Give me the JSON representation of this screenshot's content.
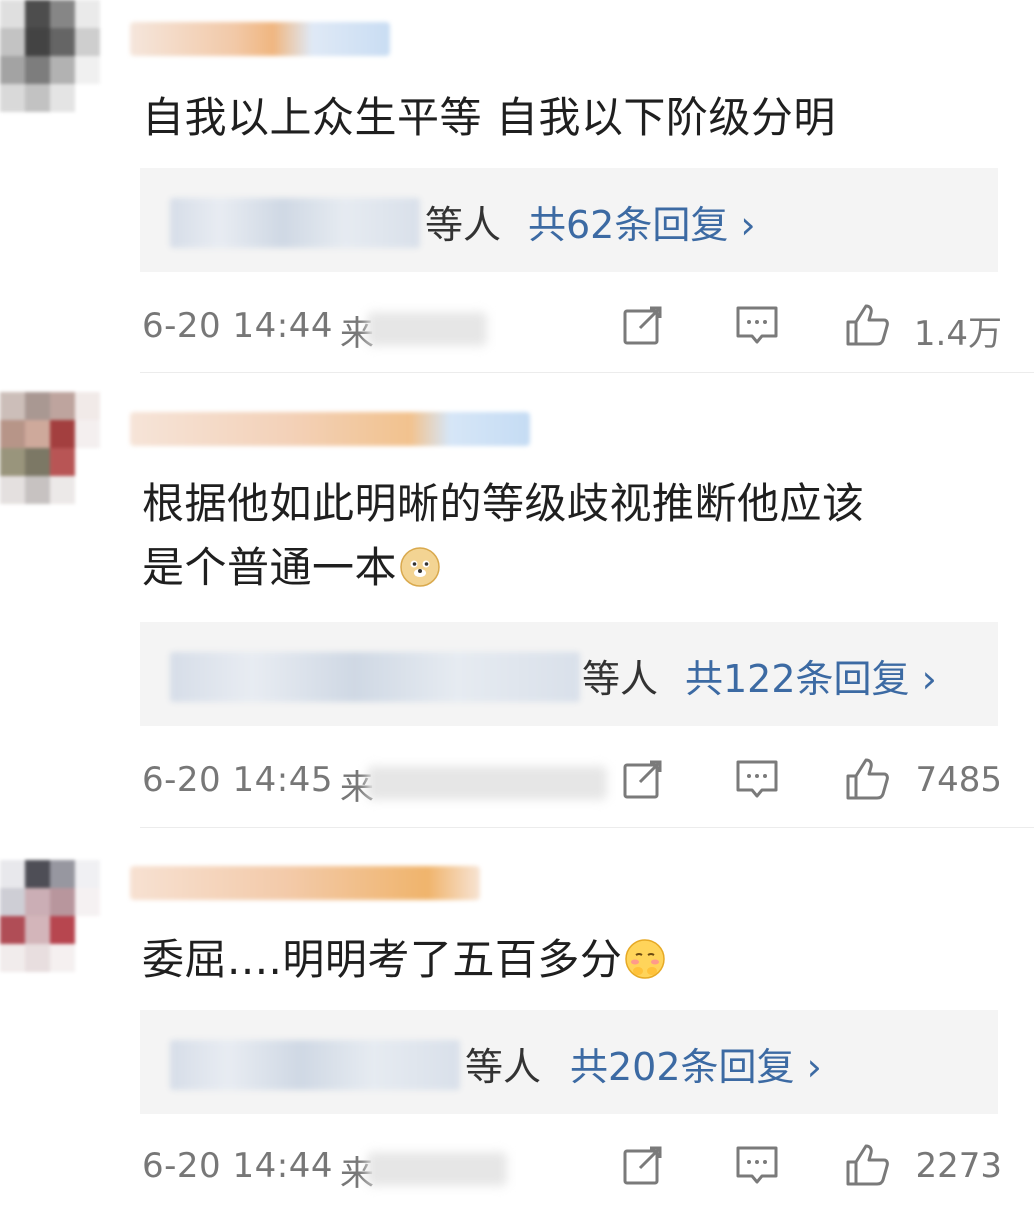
{
  "comments": [
    {
      "text_lines": [
        "自我以上众生平等 自我以下阶级分明"
      ],
      "emoji": "",
      "reply_suffix": "等人",
      "reply_count": "共62条回复 ›",
      "time": "6-20 14:44",
      "source": "来",
      "likes": "1.4万"
    },
    {
      "text_lines": [
        "根据他如此明晰的等级歧视推断他应该",
        "是个普通一本"
      ],
      "emoji": "doge-emoji",
      "reply_suffix": "等人",
      "reply_count": "共122条回复 ›",
      "time": "6-20 14:45",
      "source": "来",
      "likes": "7485"
    },
    {
      "text_lines": [
        "委屈....明明考了五百多分"
      ],
      "emoji": "shy-face-emoji",
      "reply_suffix": "等人",
      "reply_count": "共202条回复 ›",
      "time": "6-20 14:44",
      "source": "来",
      "likes": "2273"
    }
  ],
  "icons": {
    "share": "share-icon",
    "comment": "comment-icon",
    "like": "thumbs-up-icon"
  },
  "colors": {
    "link": "#3c6aa3",
    "meta": "#777777",
    "reply_bg": "#f4f4f4"
  }
}
